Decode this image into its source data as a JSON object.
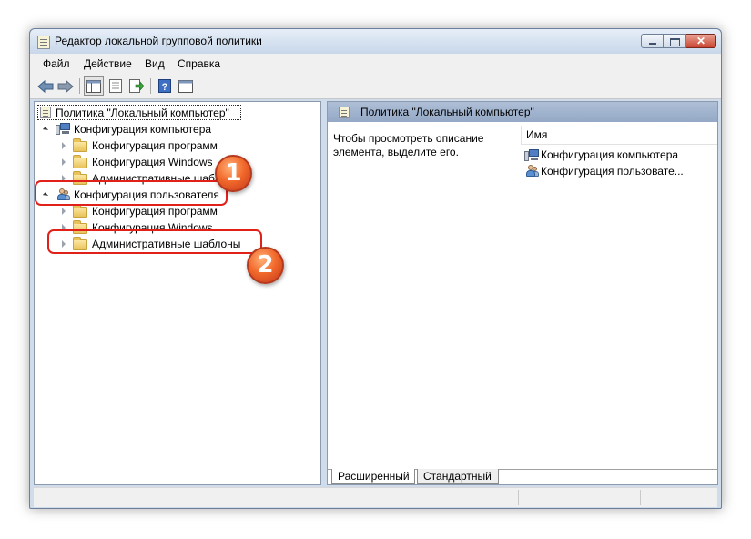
{
  "window": {
    "title": "Редактор локальной групповой политики",
    "close_glyph": "✕"
  },
  "menu": [
    "Файл",
    "Действие",
    "Вид",
    "Справка"
  ],
  "toolbar": [
    "back-icon",
    "forward-icon",
    "show-tree-icon",
    "properties-icon",
    "export-icon",
    "help-icon",
    "show-pane-icon"
  ],
  "tree": {
    "root": "Политика \"Локальный компьютер\"",
    "computer_config": "Конфигурация компьютера",
    "computer_children": [
      "Конфигурация программ",
      "Конфигурация Windows",
      "Административные шаблоны"
    ],
    "user_config": "Конфигурация пользователя",
    "user_children": [
      "Конфигурация программ",
      "Конфигурация Windows",
      "Административные шаблоны"
    ]
  },
  "right": {
    "header": "Политика \"Локальный компьютер\"",
    "description": "Чтобы просмотреть описание элемента, выделите его.",
    "column_name": "Имя",
    "items": [
      "Конфигурация компьютера",
      "Конфигурация пользовате..."
    ]
  },
  "tabs": [
    "Расширенный",
    "Стандартный"
  ],
  "annotations": {
    "step1": "1",
    "step2": "2",
    "color": "#e2201a"
  }
}
